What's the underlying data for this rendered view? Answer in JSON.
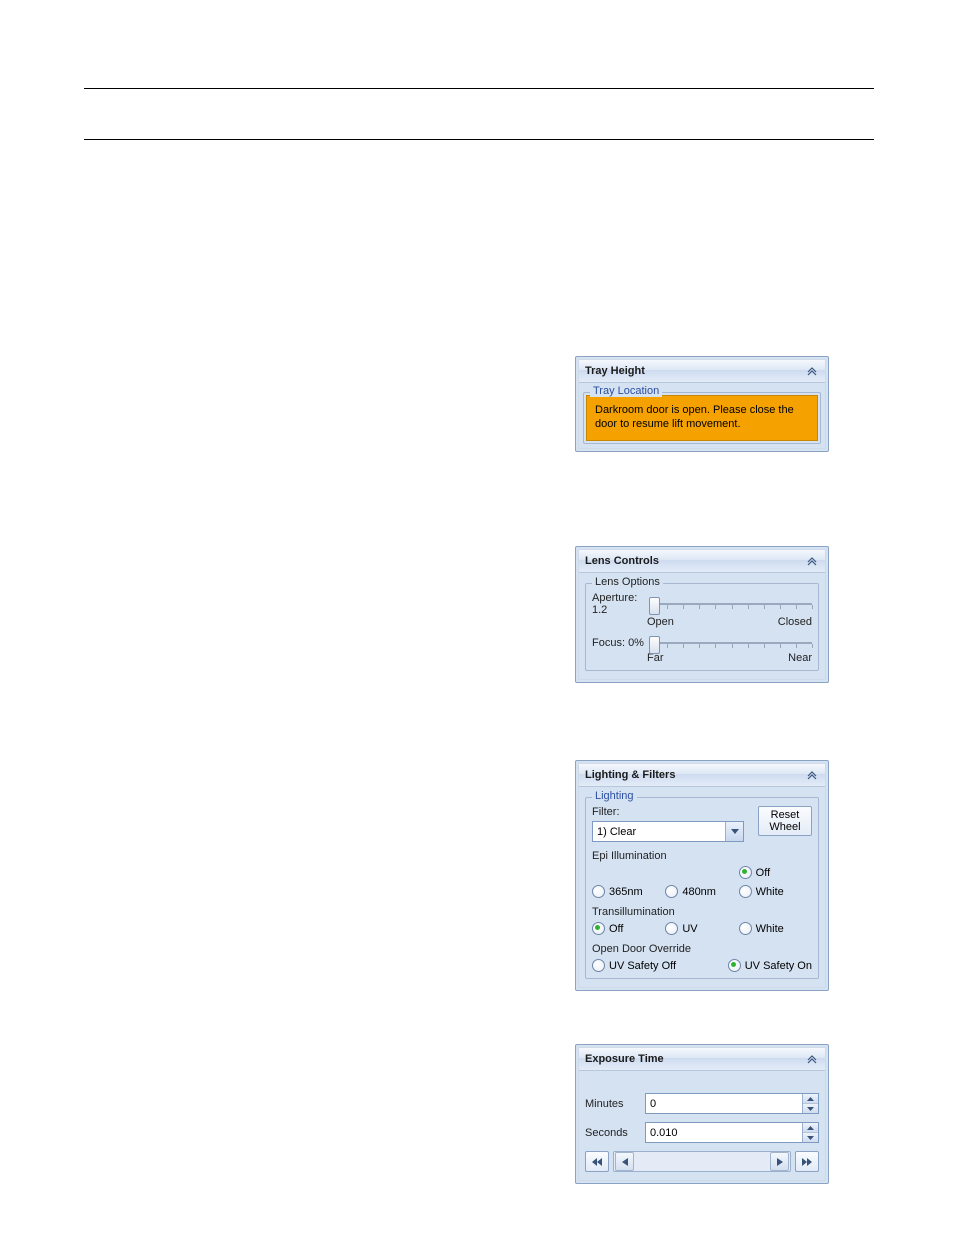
{
  "trayHeight": {
    "title": "Tray Height",
    "group": "Tray Location",
    "warning": "Darkroom door is open. Please close the door to resume lift movement."
  },
  "lensControls": {
    "title": "Lens Controls",
    "group": "Lens Options",
    "apertureLabel": "Aperture: 1.2",
    "apertureLeft": "Open",
    "apertureRight": "Closed",
    "focusLabel": "Focus: 0%",
    "focusLeft": "Far",
    "focusRight": "Near"
  },
  "lighting": {
    "title": "Lighting & Filters",
    "group": "Lighting",
    "filterLabel": "Filter:",
    "filterValue": "1) Clear",
    "resetWheel": "Reset Wheel",
    "epiLabel": "Epi Illumination",
    "epi": {
      "o365": "365nm",
      "o480": "480nm",
      "off": "Off",
      "white": "White"
    },
    "transLabel": "Transillumination",
    "trans": {
      "off": "Off",
      "uv": "UV",
      "white": "White"
    },
    "overrideLabel": "Open Door Override",
    "override": {
      "off": "UV Safety Off",
      "on": "UV Safety On"
    }
  },
  "exposure": {
    "title": "Exposure Time",
    "minutesLabel": "Minutes",
    "minutesValue": "0",
    "secondsLabel": "Seconds",
    "secondsValue": "0.010"
  }
}
